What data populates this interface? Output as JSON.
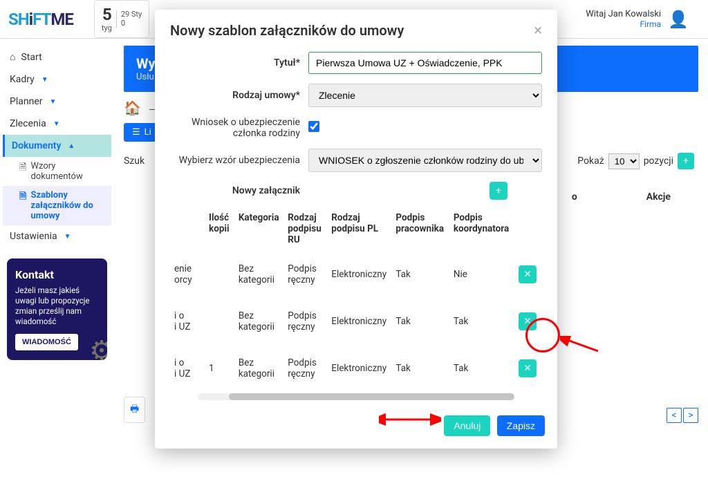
{
  "topbar": {
    "logo_part1": "SH",
    "logo_part2": "i",
    "logo_part3": "FT",
    "logo_part4": "ME",
    "date_num": "5",
    "date_day": "tyg",
    "date_line1": "29 Sty",
    "date_line2": "0",
    "user_greeting": "Witaj Jan Kowalski",
    "user_firm": "Firma"
  },
  "sidebar": {
    "items": [
      {
        "icon": "⌂",
        "label": "Start",
        "caret": false
      },
      {
        "icon": "",
        "label": "Kadry",
        "caret": true
      },
      {
        "icon": "",
        "label": "Planner",
        "caret": true
      },
      {
        "icon": "",
        "label": "Zlecenia",
        "caret": true
      },
      {
        "icon": "",
        "label": "Dokumenty",
        "caret": true,
        "active": true
      },
      {
        "icon": "",
        "label": "Ustawienia",
        "caret": true
      }
    ],
    "subitems": [
      {
        "icon": "🗎",
        "label": "Wzory dokumentów"
      },
      {
        "icon": "🗎",
        "label": "Szablony załączników do umowy",
        "active": true
      }
    ],
    "kontakt_title": "Kontakt",
    "kontakt_text": "Jeżeli masz jakieś uwagi lub propozycje zmian prześlij nam wiadomość",
    "kontakt_btn": "WIADOMOŚĆ"
  },
  "main": {
    "hero_title": "Wy",
    "hero_sub": "Usłu",
    "tab_label": "Li",
    "search_label": "Szuk",
    "pokaz_label": "Pokaż",
    "pokaz_value": "10",
    "pokaz_suffix": "pozycji",
    "th_o": "o",
    "th_akcje": "Akcje"
  },
  "modal": {
    "title": "Nowy szablon załączników do umowy",
    "labels": {
      "tytul": "Tytuł*",
      "rodzaj_umowy": "Rodzaj umowy*",
      "wniosek": "Wniosek o ubezpieczenie członka rodziny",
      "wybierz_wzor": "Wybierz wzór ubezpieczenia",
      "nowy_zalacznik": "Nowy załącznik"
    },
    "values": {
      "tytul": "Pierwsza Umowa UZ + Oświadczenie, PPK",
      "rodzaj_umowy": "Zlecenie",
      "wniosek_checked": true,
      "wzor": "WNIOSEK o zgłoszenie członków rodziny do ub"
    },
    "columns": [
      "Ilość kopii",
      "Kategoria",
      "Rodzaj podpisu RU",
      "Rodzaj podpisu PL",
      "Podpis pracownika",
      "Podpis koordynatora"
    ],
    "col0_blank": "",
    "rows": [
      {
        "c0a": "enie",
        "c0b": "orcy",
        "ilosc": "",
        "kategoria": "Bez kategorii",
        "podpis_ru": "Podpis ręczny",
        "podpis_pl": "Elektroniczny",
        "pracownik": "Tak",
        "koordynator": "Nie"
      },
      {
        "c0a": "i o",
        "c0b": "i UZ",
        "ilosc": "",
        "kategoria": "Bez kategorii",
        "podpis_ru": "Podpis ręczny",
        "podpis_pl": "Elektroniczny",
        "pracownik": "Tak",
        "koordynator": "Tak"
      },
      {
        "c0a": "i o",
        "c0b": "i UZ",
        "ilosc": "1",
        "kategoria": "Bez kategorii",
        "podpis_ru": "Podpis ręczny",
        "podpis_pl": "Elektroniczny",
        "pracownik": "Tak",
        "koordynator": "Tak"
      }
    ],
    "footer": {
      "cancel": "Anuluj",
      "save": "Zapisz"
    }
  }
}
